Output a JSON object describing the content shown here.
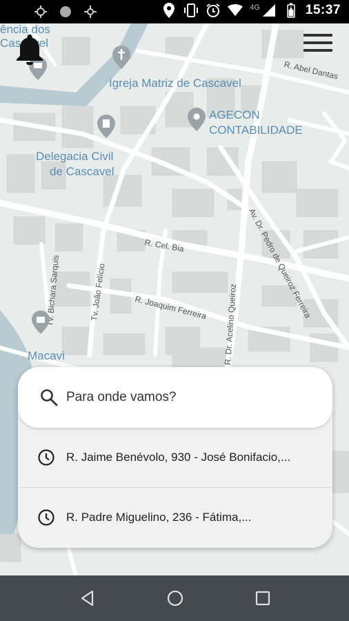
{
  "status_bar": {
    "network_type": "4G",
    "time": "15:37",
    "icons": [
      "location-sync-icon",
      "circle-notification-icon",
      "settings-sync-icon",
      "location-pin-icon",
      "vibrate-icon",
      "alarm-icon",
      "wifi-icon",
      "signal-icon",
      "battery-icon"
    ]
  },
  "map": {
    "places": {
      "church": "Igreja Matriz de Cascavel",
      "agecon_line1": "AGECON",
      "agecon_line2": "CONTABILIDADE",
      "delegacia_line1": "Delegacia Civil",
      "delegacia_line2": "de Cascavel",
      "macavi": "Macavi",
      "top_left_line1": "ência dos",
      "top_left_line2": "Cascavel"
    },
    "streets": {
      "abel_dantas": "R. Abel Dantas",
      "cel_bia": "R. Cel. Bia",
      "joaquim_ferreira": "R. Joaquim Ferreira",
      "acelino_queiroz": "R. Dr. Acelino Queiroz",
      "pedro_queiroz": "Av. Dr. Pedro de Queiroz Ferreira",
      "joao_felicio": "Tv. João Felício",
      "bichara_sarquis": "Tv. Bichara Sarquis"
    }
  },
  "controls": {
    "bell_icon": "bell-icon",
    "menu_icon": "hamburger-menu-icon"
  },
  "search": {
    "placeholder": "Para onde vamos?"
  },
  "history": [
    {
      "address": "R. Jaime Benévolo, 930 - José Bonifacio,..."
    },
    {
      "address": "R. Padre Miguelino, 236 - Fátima,..."
    }
  ],
  "nav_bar": [
    "back-icon",
    "home-icon",
    "recents-icon"
  ]
}
